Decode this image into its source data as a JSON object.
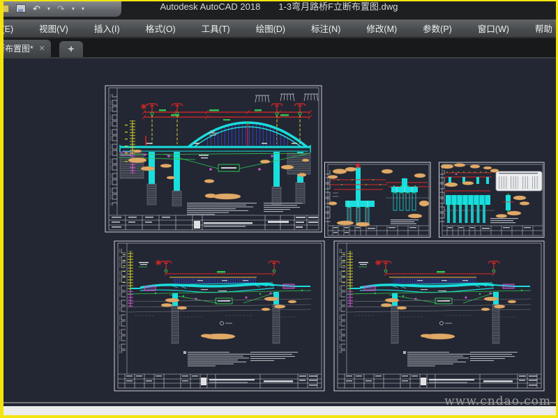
{
  "window": {
    "app_title": "Autodesk AutoCAD 2018",
    "file_name": "1-3弯月路桥F立断布置图.dwg"
  },
  "quick_access_toolbar": {
    "icons": [
      "open-icon",
      "save-icon",
      "undo-icon",
      "redo-icon",
      "dropdown-icon"
    ]
  },
  "menu_bar": {
    "items": [
      "辑(E)",
      "视图(V)",
      "插入(I)",
      "格式(O)",
      "工具(T)",
      "绘图(D)",
      "标注(N)",
      "修改(M)",
      "参数(P)",
      "窗口(W)",
      "帮助"
    ]
  },
  "tab_bar": {
    "active_tab": {
      "label": "断布置图*",
      "modified": true,
      "close_label": "✕"
    },
    "new_tab_label": "+"
  },
  "canvas": {
    "background": "#232733",
    "drawings": [
      {
        "name": "arch-bridge-elevation-sheet"
      },
      {
        "name": "pier-general-detail-sheet"
      },
      {
        "name": "pile-foundation-detail-sheet"
      },
      {
        "name": "girder-bridge-elevation-sheet-left"
      },
      {
        "name": "girder-bridge-elevation-sheet-right"
      }
    ]
  },
  "watermark": "www.cndao.com",
  "colors": {
    "yellow_border": "#f3e50c",
    "titlebar_bg": "#1d1f21",
    "menu_bg": "#4a4d4f",
    "canvas_bg": "#232733",
    "frame_white": "#cfd2d6",
    "cad_cyan": "#19dede",
    "cad_red": "#e02525",
    "cad_green": "#2ec552",
    "cad_blue": "#2a3fd0",
    "cad_yellow": "#d6d62a",
    "cad_magenta": "#d355d3",
    "cad_tan": "#dfa968",
    "watermark_grey": "#9b9b9b"
  }
}
